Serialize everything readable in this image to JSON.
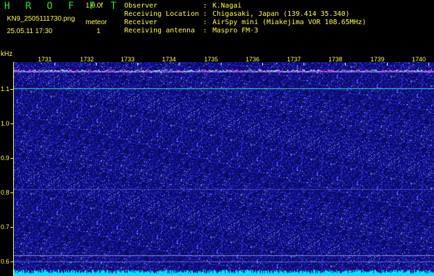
{
  "header": {
    "logo": "H R O F F T",
    "version": "1.0.0f",
    "filename": "KN9_2505111730.png",
    "meteor_label": "meteor",
    "timestamp": "25.05.11 17:30",
    "meteor_count": "1",
    "info": [
      {
        "key": "Observer",
        "value": "K.Nagai"
      },
      {
        "key": "Receiving Location",
        "value": "Chigasaki, Japan (139.414 35.340)"
      },
      {
        "key": "Receiver",
        "value": "AirSpy mini (Miakejima VOR 108.65MHz)"
      },
      {
        "key": "Receiving antenna",
        "value": "Maspro FM-3"
      }
    ]
  },
  "spectrogram": {
    "y_unit": "kHz",
    "y_ticks": [
      "1.1",
      "1.0",
      "0.9",
      "0.8",
      "0.7",
      "0.6"
    ],
    "time_labels": [
      "1731",
      "1732",
      "1733",
      "1734",
      "1735",
      "1736",
      "1737",
      "1738",
      "1739",
      "1740"
    ],
    "colors": {
      "background": "#0a0a5c",
      "noise": "#3a3aff",
      "text": "#ffff40",
      "signal": "#40ffd0",
      "floor": "#00e5ff"
    }
  }
}
